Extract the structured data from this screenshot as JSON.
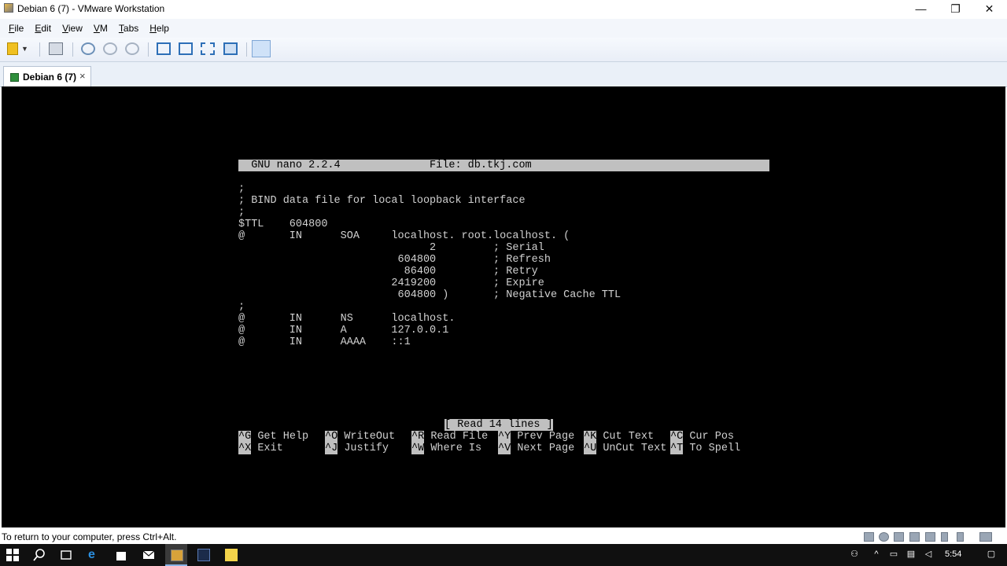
{
  "window": {
    "title": "Debian 6 (7) - VMware Workstation"
  },
  "menu": [
    {
      "key": "F",
      "rest": "ile"
    },
    {
      "key": "E",
      "rest": "dit"
    },
    {
      "key": "V",
      "rest": "iew"
    },
    {
      "key": "V",
      "rest": "M"
    },
    {
      "key": "T",
      "rest": "abs"
    },
    {
      "key": "H",
      "rest": "elp"
    }
  ],
  "tab": {
    "label": "Debian 6 (7)",
    "close": "×"
  },
  "nano": {
    "header": "  GNU nano 2.2.4              File: db.tkj.com                                ",
    "lines": [
      ";",
      "; BIND data file for local loopback interface",
      ";",
      "$TTL    604800",
      "@       IN      SOA     localhost. root.localhost. (",
      "                              2         ; Serial",
      "                         604800         ; Refresh",
      "                          86400         ; Retry",
      "                        2419200         ; Expire",
      "                         604800 )       ; Negative Cache TTL",
      ";",
      "@       IN      NS      localhost.",
      "@       IN      A       127.0.0.1",
      "@       IN      AAAA    ::1"
    ],
    "status_message": "[ Read 14 lines ]",
    "shortcuts_row1": [
      {
        "key": "^G",
        "label": "Get Help"
      },
      {
        "key": "^O",
        "label": "WriteOut"
      },
      {
        "key": "^R",
        "label": "Read File"
      },
      {
        "key": "^Y",
        "label": "Prev Page"
      },
      {
        "key": "^K",
        "label": "Cut Text"
      },
      {
        "key": "^C",
        "label": "Cur Pos"
      }
    ],
    "shortcuts_row2": [
      {
        "key": "^X",
        "label": "Exit"
      },
      {
        "key": "^J",
        "label": "Justify"
      },
      {
        "key": "^W",
        "label": "Where Is"
      },
      {
        "key": "^V",
        "label": "Next Page"
      },
      {
        "key": "^U",
        "label": "UnCut Text"
      },
      {
        "key": "^T",
        "label": "To Spell"
      }
    ]
  },
  "statusbar": {
    "text": "To return to your computer, press Ctrl+Alt."
  },
  "taskbar": {
    "time": "5:54"
  },
  "colors": {
    "console_bg": "#000000",
    "terminal_text": "#d0d0d0",
    "nano_bar": "#c0c0c0"
  }
}
